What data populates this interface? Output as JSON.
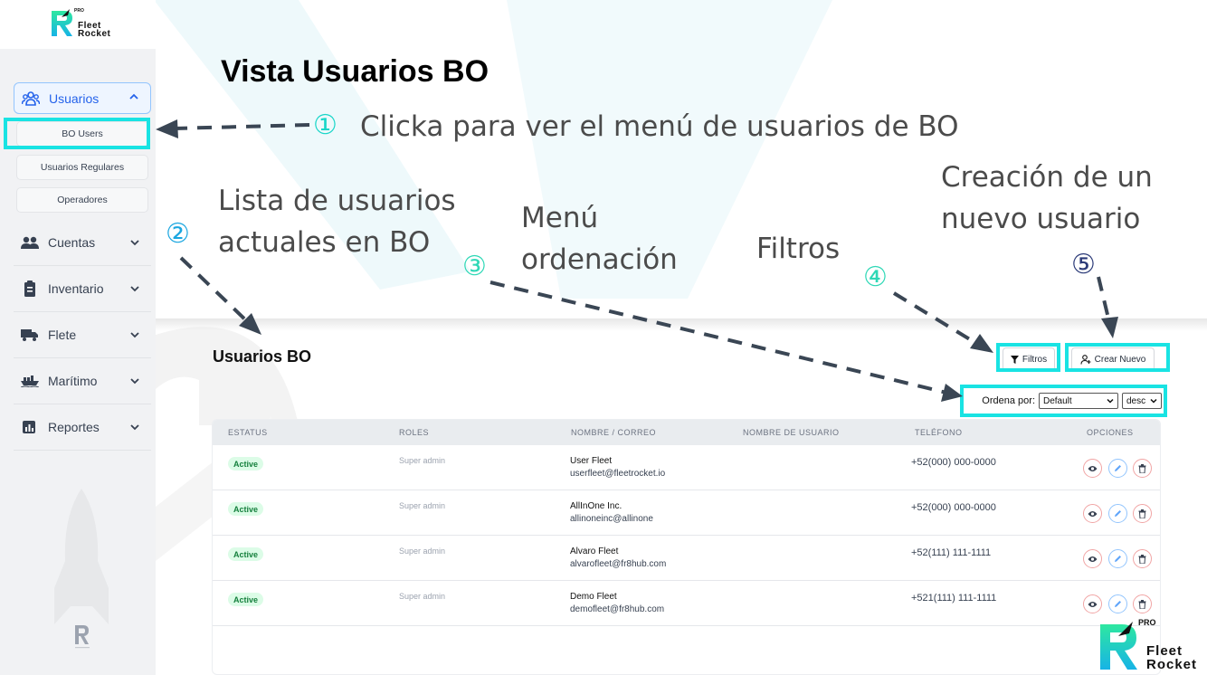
{
  "brand": {
    "pro": "PRO",
    "name_line1": "Fleet",
    "name_line2": "Rocket",
    "accent": "#19e3e3",
    "logo_gradient": [
      "#2ee8a0",
      "#17b3e6"
    ]
  },
  "sidebar": {
    "group": {
      "label": "Usuarios",
      "icon": "users-icon"
    },
    "sub_items": [
      {
        "label": "BO Users"
      },
      {
        "label": "Usuarios Regulares"
      },
      {
        "label": "Operadores"
      }
    ],
    "items": [
      {
        "label": "Cuentas",
        "icon": "people-icon"
      },
      {
        "label": "Inventario",
        "icon": "clipboard-icon"
      },
      {
        "label": "Flete",
        "icon": "truck-icon"
      },
      {
        "label": "Marítimo",
        "icon": "ship-icon"
      },
      {
        "label": "Reportes",
        "icon": "chart-icon"
      }
    ]
  },
  "annotations": {
    "title": "Vista Usuarios BO",
    "a1": {
      "num": "①",
      "text": "Clicka para ver el menú de usuarios de BO"
    },
    "a2": {
      "num": "②",
      "line1": "Lista de usuarios",
      "line2": "actuales en BO"
    },
    "a3": {
      "num": "③",
      "line1": "Menú",
      "line2": "ordenación"
    },
    "a4": {
      "num": "④",
      "text": "Filtros"
    },
    "a5": {
      "num": "⑤",
      "line1": "Creación de un",
      "line2": "nuevo usuario"
    }
  },
  "page": {
    "title": "Usuarios BO",
    "filter_button": "Filtros",
    "create_button": "Crear Nuevo",
    "order_label": "Ordena por:",
    "order_value": "Default",
    "order_dir": "desc"
  },
  "table": {
    "headers": [
      "ESTATUS",
      "ROLES",
      "NOMBRE / CORREO",
      "NOMBRE DE USUARIO",
      "TELÉFONO",
      "OPCIONES"
    ],
    "rows": [
      {
        "status": "Active",
        "role": "Super admin",
        "name": "User Fleet",
        "email": "userfleet@fleetrocket.io",
        "phone": "+52(000) 000-0000"
      },
      {
        "status": "Active",
        "role": "Super admin",
        "name": "AllInOne Inc.",
        "email": "allinoneinc@allinone",
        "phone": "+52(000) 000-0000"
      },
      {
        "status": "Active",
        "role": "Super admin",
        "name": "Alvaro Fleet",
        "email": "alvarofleet@fr8hub.com",
        "phone": "+52(111) 111-1111"
      },
      {
        "status": "Active",
        "role": "Super admin",
        "name": "Demo Fleet",
        "email": "demofleet@fr8hub.com",
        "phone": "+521(111) 111-1111"
      }
    ]
  }
}
